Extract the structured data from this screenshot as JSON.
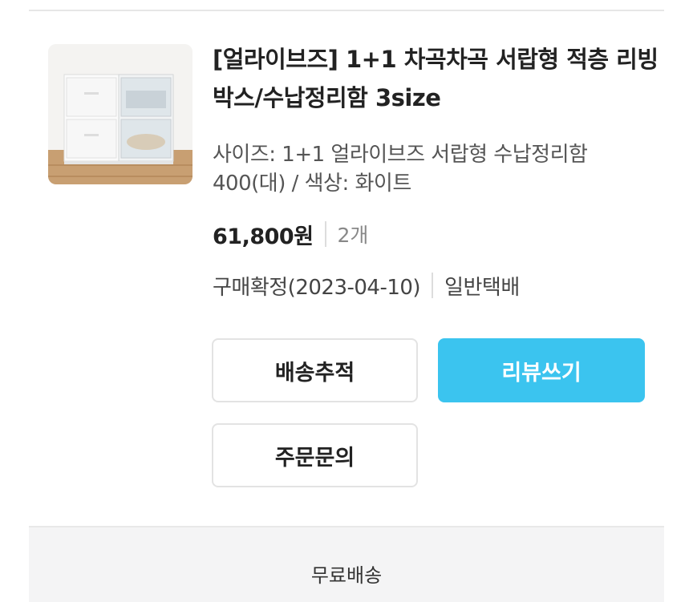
{
  "order_item": {
    "product_image": {
      "alt": "white drawer storage boxes"
    },
    "title": "[얼라이브즈] 1+1 차곡차곡 서랍형 적층 리빙박스/수납정리함 3size",
    "option": "사이즈: 1+1 얼라이브즈 서랍형 수납정리함 400(대) / 색상: 화이트",
    "price": "61,800원",
    "quantity": "2개",
    "status": "구매확정(2023-04-10)",
    "delivery_type": "일반택배"
  },
  "actions": {
    "track_label": "배송추적",
    "review_label": "리뷰쓰기",
    "inquiry_label": "주문문의"
  },
  "footer": {
    "shipping_label": "무료배송"
  },
  "colors": {
    "primary": "#3bc4ef",
    "border": "#e3e3e3",
    "footer_bg": "#f4f4f5"
  }
}
